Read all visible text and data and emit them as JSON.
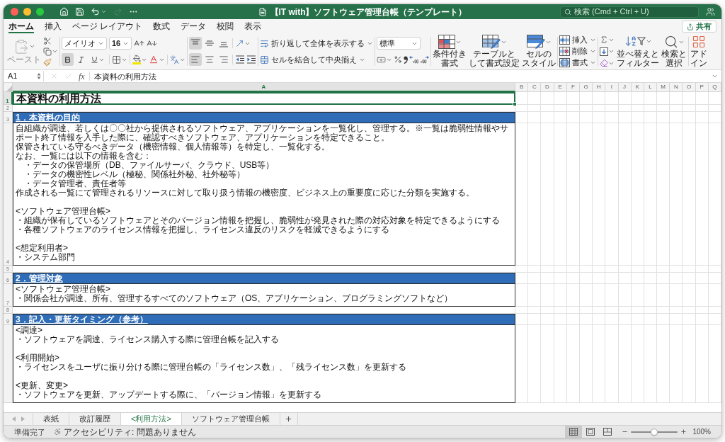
{
  "window": {
    "title": "【IT with】ソフトウェア管理台帳（テンプレート）"
  },
  "quick_access": [
    {
      "kind": "home",
      "disabled": false
    },
    {
      "kind": "save",
      "disabled": false
    },
    {
      "kind": "undo",
      "disabled": false
    },
    {
      "kind": "redo",
      "disabled": true
    },
    {
      "kind": "more",
      "disabled": false
    }
  ],
  "search": {
    "placeholder": "検索 (Cmd + Ctrl + U)"
  },
  "ribbon_tabs": [
    {
      "label": "ホーム",
      "selected": true
    },
    {
      "label": "挿入",
      "selected": false
    },
    {
      "label": "ページ レイアウト",
      "selected": false
    },
    {
      "label": "数式",
      "selected": false
    },
    {
      "label": "データ",
      "selected": false
    },
    {
      "label": "校閲",
      "selected": false
    },
    {
      "label": "表示",
      "selected": false
    }
  ],
  "share_button": {
    "label": "共有"
  },
  "ribbon": {
    "paste": {
      "label": "ペースト",
      "disabled": true
    },
    "font_name": "メイリオ",
    "font_size": "16",
    "font_style_buttons": [
      {
        "kind": "bold",
        "on": true
      },
      {
        "kind": "italic",
        "on": false
      },
      {
        "kind": "underline",
        "on": false
      }
    ],
    "vertical_align": [
      {
        "kind": "top",
        "selected": true
      },
      {
        "kind": "middle",
        "selected": false
      },
      {
        "kind": "bottom",
        "selected": false
      }
    ],
    "horizontal_align": [
      {
        "kind": "left",
        "selected": true
      },
      {
        "kind": "center",
        "selected": false
      },
      {
        "kind": "right",
        "selected": false
      }
    ],
    "wrap_text": "折り返して全体を表示する",
    "merge_center": "セルを結合して中央揃え",
    "number_format": "標準",
    "style_buttons": [
      {
        "kind": "conditional",
        "lines": [
          "条件付き",
          "書式"
        ]
      },
      {
        "kind": "table",
        "lines": [
          "テーブルと",
          "して書式設定"
        ]
      },
      {
        "kind": "cell_styles",
        "lines": [
          "セルの",
          "スタイル"
        ]
      }
    ],
    "cell_buttons": [
      {
        "kind": "insert",
        "label": "挿入"
      },
      {
        "kind": "delete",
        "label": "削除"
      },
      {
        "kind": "format",
        "label": "書式"
      }
    ],
    "edit_buttons": [
      {
        "kind": "sort_filter",
        "lines": [
          "並べ替えと",
          "フィルター"
        ]
      },
      {
        "kind": "find",
        "lines": [
          "検索と",
          "選択"
        ]
      }
    ],
    "addins_button": {
      "lines": [
        "アド",
        "イン"
      ]
    }
  },
  "formula_bar": {
    "name_box": "A1",
    "editing": false,
    "function_label": "fx",
    "content": "本資料の利用方法"
  },
  "columns": [
    {
      "label": "A",
      "selected": true
    },
    {
      "label": "B",
      "selected": false
    },
    {
      "label": "C",
      "selected": false
    },
    {
      "label": "D",
      "selected": false
    },
    {
      "label": "E",
      "selected": false
    },
    {
      "label": "F",
      "selected": false
    },
    {
      "label": "G",
      "selected": false
    },
    {
      "label": "H",
      "selected": false
    },
    {
      "label": "I",
      "selected": false
    },
    {
      "label": "J",
      "selected": false
    },
    {
      "label": "K",
      "selected": false
    },
    {
      "label": "L",
      "selected": false
    },
    {
      "label": "M",
      "selected": false
    },
    {
      "label": "N",
      "selected": false
    },
    {
      "label": "O",
      "selected": false
    },
    {
      "label": "P",
      "selected": false
    },
    {
      "label": "Q",
      "selected": false
    }
  ],
  "rows": [
    {
      "number": "1",
      "selected": true,
      "kind": "title",
      "text": "本資料の利用方法"
    },
    {
      "number": "2",
      "selected": false,
      "kind": "blank"
    },
    {
      "number": "3",
      "selected": false,
      "kind": "heading",
      "text": "1．本資料の目的"
    },
    {
      "number": "4",
      "selected": false,
      "kind": "body",
      "paragraphs": [
        [
          "自組織が調達、若しくは〇〇社から提供されるソフトウェア、アプリケーションを一覧化し、管理する。※一覧は脆弱性情報やサポート終了情報を入手した際に、確認すべきソフトウェア、アプリケーションを特定できること。",
          "保管されている守るべきデータ（機密情報、個人情報等）を特定し、一覧化する。",
          "なお、一覧には以下の情報を含む：",
          "　・データの保管場所（DB、ファイルサーバ、クラウド、USB等）",
          "　・データの機密性レベル（極秘、関係社外秘、社外秘等）",
          "　・データ管理者、責任者等",
          "作成される一覧にて管理されるリソースに対して取り扱う情報の機密度、ビジネス上の重要度に応じた分類を実施する。"
        ],
        [
          "<ソフトウェア管理台帳>",
          "・組織が保有しているソフトウェアとそのバージョン情報を把握し、脆弱性が発見された際の対応対象を特定できるようにする",
          "・各種ソフトウェアのライセンス情報を把握し、ライセンス違反のリスクを軽減できるようにする"
        ],
        [
          "<想定利用者>",
          "・システム部門"
        ]
      ]
    },
    {
      "number": "5",
      "selected": false,
      "kind": "blank"
    },
    {
      "number": "6",
      "selected": false,
      "kind": "heading",
      "text": "2．管理対象"
    },
    {
      "number": "7",
      "selected": false,
      "kind": "body",
      "paragraphs": [
        [
          "<ソフトウェア管理台帳>",
          "・関係会社が調達、所有、管理するすべてのソフトウェア（OS、アプリケーション、プログラミングソフトなど）"
        ]
      ]
    },
    {
      "number": "8",
      "selected": false,
      "kind": "blank"
    },
    {
      "number": "9",
      "selected": false,
      "kind": "heading",
      "text": "3．記入・更新タイミング（参考）"
    },
    {
      "selected": false,
      "kind": "body",
      "paragraphs": [
        [
          "<調達>",
          "・ソフトウェアを調達、ライセンス購入する際に管理台帳を記入する"
        ],
        [
          "<利用開始>",
          "・ライセンスをユーザに振り分ける際に管理台帳の「ライセンス数」、「残ライセンス数」を更新する"
        ],
        [
          "<更新、変更>",
          "・ソフトウェアを更新、アップデートする際に、「バージョン情報」を更新する"
        ]
      ]
    }
  ],
  "sheet_tabs": [
    {
      "label": "表紙",
      "selected": false
    },
    {
      "label": "改訂履歴",
      "selected": false
    },
    {
      "label": "<利用方法>",
      "selected": true
    },
    {
      "label": "ソフトウェア管理台帳",
      "selected": false
    }
  ],
  "status_bar": {
    "ready": "準備完了",
    "accessibility": "アクセシビリティ: 問題ありません",
    "views": [
      {
        "kind": "normal",
        "selected": true
      },
      {
        "kind": "page_layout",
        "selected": false
      },
      {
        "kind": "page_break",
        "selected": false
      }
    ],
    "zoom": {
      "level": 0.5,
      "reading": "100%"
    }
  }
}
